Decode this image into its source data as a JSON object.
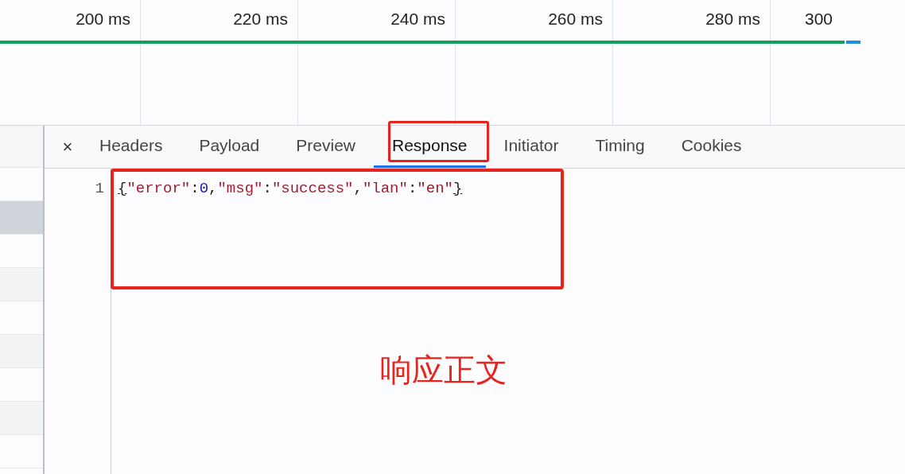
{
  "timeline": {
    "ticks": [
      "200 ms",
      "220 ms",
      "240 ms",
      "260 ms",
      "280 ms",
      "300"
    ]
  },
  "request_rows": [
    {
      "selected": false
    },
    {
      "selected": true
    },
    {
      "selected": false
    },
    {
      "selected": false
    },
    {
      "selected": false
    },
    {
      "selected": false
    },
    {
      "selected": false
    },
    {
      "selected": false
    },
    {
      "selected": false
    }
  ],
  "tabs": [
    {
      "label": "Headers",
      "selected": false
    },
    {
      "label": "Payload",
      "selected": false
    },
    {
      "label": "Preview",
      "selected": false
    },
    {
      "label": "Response",
      "selected": true
    },
    {
      "label": "Initiator",
      "selected": false
    },
    {
      "label": "Timing",
      "selected": false
    },
    {
      "label": "Cookies",
      "selected": false
    }
  ],
  "close_label": "×",
  "response": {
    "lines": [
      {
        "number": "1",
        "tokens": [
          {
            "kind": "brace",
            "text": "{"
          },
          {
            "kind": "string",
            "text": "\"error\""
          },
          {
            "kind": "punct",
            "text": ":"
          },
          {
            "kind": "number",
            "text": "0"
          },
          {
            "kind": "punct",
            "text": ","
          },
          {
            "kind": "string",
            "text": "\"msg\""
          },
          {
            "kind": "punct",
            "text": ":"
          },
          {
            "kind": "string",
            "text": "\"success\""
          },
          {
            "kind": "punct",
            "text": ","
          },
          {
            "kind": "string",
            "text": "\"lan\""
          },
          {
            "kind": "punct",
            "text": ":"
          },
          {
            "kind": "string",
            "text": "\"en\""
          },
          {
            "kind": "brace",
            "text": "}"
          }
        ]
      }
    ]
  },
  "annotation": {
    "label": "响应正文"
  }
}
